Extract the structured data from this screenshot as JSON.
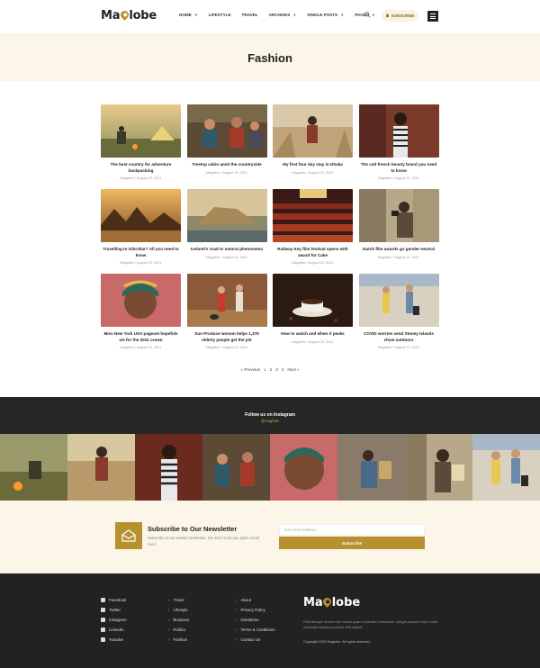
{
  "brand": {
    "logo_prefix": "Ma",
    "logo_suffix": "lobe"
  },
  "nav": {
    "items": [
      {
        "label": "Home",
        "has_dropdown": true
      },
      {
        "label": "Lifestyle",
        "has_dropdown": false
      },
      {
        "label": "Travel",
        "has_dropdown": false
      },
      {
        "label": "Archives",
        "has_dropdown": true
      },
      {
        "label": "Single Posts",
        "has_dropdown": true
      },
      {
        "label": "Pages",
        "has_dropdown": true
      }
    ],
    "search_icon": "search-icon",
    "subscribe_label": "Subscribe",
    "menu_icon": "hamburger-menu-icon"
  },
  "page": {
    "title": "Fashion"
  },
  "posts": [
    {
      "title": "The best country for adventure backpacking",
      "meta": "Magnitex / August 22, 2021"
    },
    {
      "title": "Treetop cabin amid the countryside",
      "meta": "Magnitex / August 19, 2021"
    },
    {
      "title": "My first four day stay in Dhaka",
      "meta": "Magnitex / August 22, 2021"
    },
    {
      "title": "The cult french beauty brand you need to know",
      "meta": "Magnitex / August 22, 2021"
    },
    {
      "title": "Travelling to Gibraltar? All you need to know",
      "meta": "Magnitex / August 22, 2021"
    },
    {
      "title": "Iceland's road to natural phenomena",
      "meta": "Magnitex / August 22, 2021"
    },
    {
      "title": "Railway Key film festival opens with award for Cake",
      "meta": "Magnitex / August 22, 2021"
    },
    {
      "title": "Dutch film awards go gender-neutral",
      "meta": "Magnitex / August 22, 2021"
    },
    {
      "title": "Miss New York USA pageant hopefuls vie for the 2021 crown",
      "meta": "Magnitex / August 22, 2021"
    },
    {
      "title": "Sun Produce woman helps 1,379 elderly people get the job",
      "meta": "Magnitex / August 22, 2021"
    },
    {
      "title": "How to watch and when it peaks",
      "meta": "Magnitex / August 22, 2021"
    },
    {
      "title": "COVID worries send Stoney Islands show outdoors",
      "meta": "Magnitex / August 22, 2021"
    }
  ],
  "pagination": {
    "prev": "« Previous",
    "pages": [
      "1",
      "2",
      "3",
      "4"
    ],
    "current": "1",
    "next": "Next »"
  },
  "instagram": {
    "title": "Follow us on Instagram",
    "handle": "@maglobe"
  },
  "newsletter": {
    "icon": "envelope-icon",
    "title": "Subscribe to Our Newsletter",
    "text": "Subscribe to our weekly newsletter. We don't send any spam email ever!",
    "placeholder": "Your email address...",
    "button": "Subscribe"
  },
  "footer": {
    "social": [
      {
        "label": "Facebook",
        "icon": "facebook-icon"
      },
      {
        "label": "Twitter",
        "icon": "twitter-icon"
      },
      {
        "label": "Instagram",
        "icon": "instagram-icon"
      },
      {
        "label": "LinkedIn",
        "icon": "linkedin-icon"
      },
      {
        "label": "Youtube",
        "icon": "youtube-icon"
      }
    ],
    "categories": [
      "Travel",
      "Lifestyle",
      "Business",
      "Politics",
      "Fashion"
    ],
    "pages": [
      "About",
      "Privacy Policy",
      "Disclaimer",
      "Terms & Conditions",
      "Contact Us"
    ],
    "description": "Pellentesque ornare sem lacinia quam venenatis vestibulum. Integer posuere erat a ante venenatis dapibus posuere velit aliquet.",
    "copyright": "Copyright 2022 Maglobe. All rights reserved."
  },
  "colors": {
    "accent": "#b8912f",
    "cream": "#fbf6e8",
    "dark": "#222222"
  }
}
